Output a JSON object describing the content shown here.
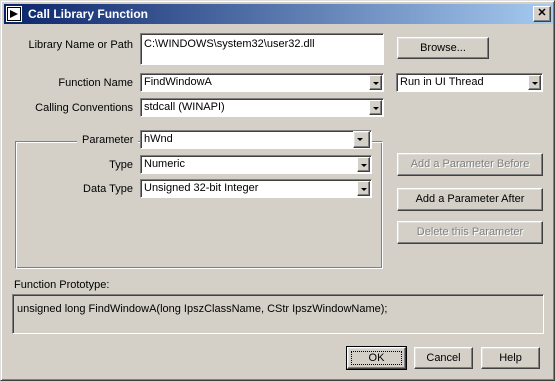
{
  "window": {
    "title": "Call Library Function",
    "close_glyph": "✕"
  },
  "library": {
    "label": "Library Name or Path",
    "value": "C:\\WINDOWS\\system32\\user32.dll",
    "browse_label": "Browse..."
  },
  "function_name": {
    "label": "Function Name",
    "value": "FindWindowA"
  },
  "thread": {
    "value": "Run in UI Thread"
  },
  "calling": {
    "label": "Calling Conventions",
    "value": "stdcall (WINAPI)"
  },
  "parameter": {
    "label": "Parameter",
    "value": "hWnd",
    "type_label": "Type",
    "type_value": "Numeric",
    "data_type_label": "Data Type",
    "data_type_value": "Unsigned 32-bit Integer"
  },
  "param_buttons": {
    "add_before": "Add a Parameter Before",
    "add_after": "Add a Parameter After",
    "delete": "Delete this Parameter"
  },
  "prototype": {
    "label": "Function Prototype:",
    "value": "unsigned long FindWindowA(long IpszClassName, CStr IpszWindowName);"
  },
  "footer": {
    "ok": "OK",
    "cancel": "Cancel",
    "help": "Help"
  },
  "icons": {
    "app": "labview-icon",
    "dropdown": "chevron-down-icon"
  }
}
